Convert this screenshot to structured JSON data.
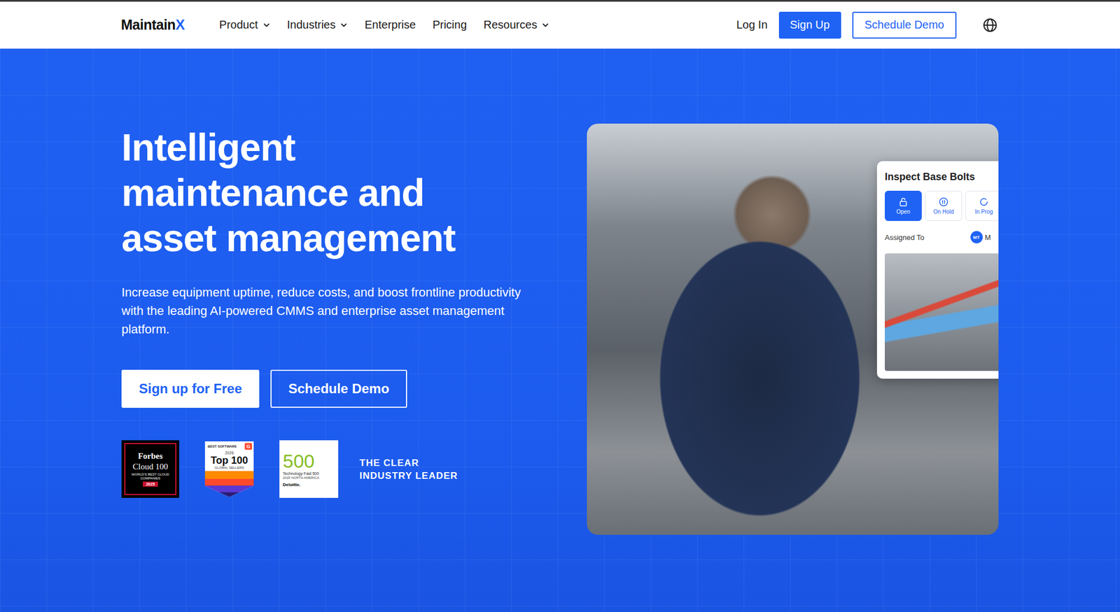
{
  "nav": {
    "logo": {
      "text": "Maintain",
      "accent": "X"
    },
    "items": [
      {
        "label": "Product",
        "dropdown": true
      },
      {
        "label": "Industries",
        "dropdown": true
      },
      {
        "label": "Enterprise",
        "dropdown": false
      },
      {
        "label": "Pricing",
        "dropdown": false
      },
      {
        "label": "Resources",
        "dropdown": true
      }
    ],
    "login": "Log In",
    "signup": "Sign Up",
    "demo": "Schedule Demo"
  },
  "hero": {
    "title": "Intelligent maintenance and asset management",
    "subtitle": "Increase equipment uptime, reduce costs, and boost frontline productivity with the leading AI-powered CMMS and enterprise asset management platform.",
    "primary": "Sign up for Free",
    "secondary": "Schedule Demo",
    "badges": [
      {
        "kind": "forbes",
        "brand": "Forbes",
        "title": "Cloud 100",
        "subtitle": "WORLD'S BEST CLOUD COMPANIES",
        "year": "2025",
        "mark": ""
      },
      {
        "kind": "g2",
        "brand": "BEST SOFTWARE",
        "mark": "G",
        "year": "2026",
        "title": "Top 100",
        "subtitle": "GLOBAL SELLERS"
      },
      {
        "kind": "deloitte",
        "title": "500",
        "subtitle": "Technology Fast 500",
        "year": "2025 NORTH AMERICA",
        "brand": "Deloitte.",
        "mark": ""
      }
    ],
    "tagline": [
      "THE CLEAR",
      "INDUSTRY LEADER"
    ]
  },
  "work_order": {
    "title": "Inspect Base Bolts",
    "statuses": [
      {
        "label": "Open",
        "kind": "lock",
        "selected": true
      },
      {
        "label": "On Hold",
        "kind": "pause",
        "selected": false
      },
      {
        "label": "In Prog",
        "kind": "progress",
        "selected": false
      }
    ],
    "assigned_label": "Assigned To",
    "assignee_initials": "MT",
    "assignee_name": "M"
  }
}
